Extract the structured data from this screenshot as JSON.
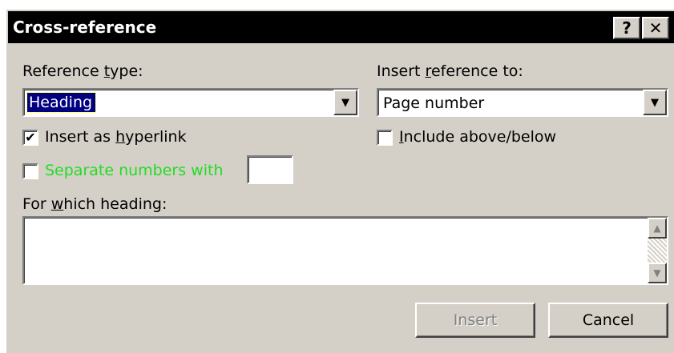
{
  "window": {
    "title": "Cross-reference",
    "help_glyph": "?",
    "close_glyph": "✕"
  },
  "reference_type": {
    "label_pre": "Reference ",
    "label_key": "t",
    "label_post": "ype:",
    "selected": "Heading"
  },
  "insert_reference_to": {
    "label_pre": "Insert ",
    "label_key": "r",
    "label_post": "eference to:",
    "selected": "Page number"
  },
  "options": {
    "hyperlink": {
      "pre": "Insert as ",
      "key": "h",
      "post": "yperlink",
      "checked": true,
      "check_glyph": "✔"
    },
    "include_above_below": {
      "pre": "",
      "key": "I",
      "post": "nclude above/below",
      "checked": false
    },
    "separate_numbers": {
      "label": "Separate numbers with",
      "checked": false,
      "value": "",
      "label_color": "#22dd22"
    }
  },
  "for_which": {
    "label_pre": "For ",
    "label_key": "w",
    "label_post": "hich heading:",
    "items": []
  },
  "buttons": {
    "insert": "Insert",
    "cancel": "Cancel"
  },
  "icons": {
    "dropdown": "chevron-down-icon",
    "scroll_up": "scroll-up-arrow-icon",
    "scroll_down": "scroll-down-arrow-icon"
  },
  "glyphs": {
    "down": "▼",
    "up": "▲"
  }
}
